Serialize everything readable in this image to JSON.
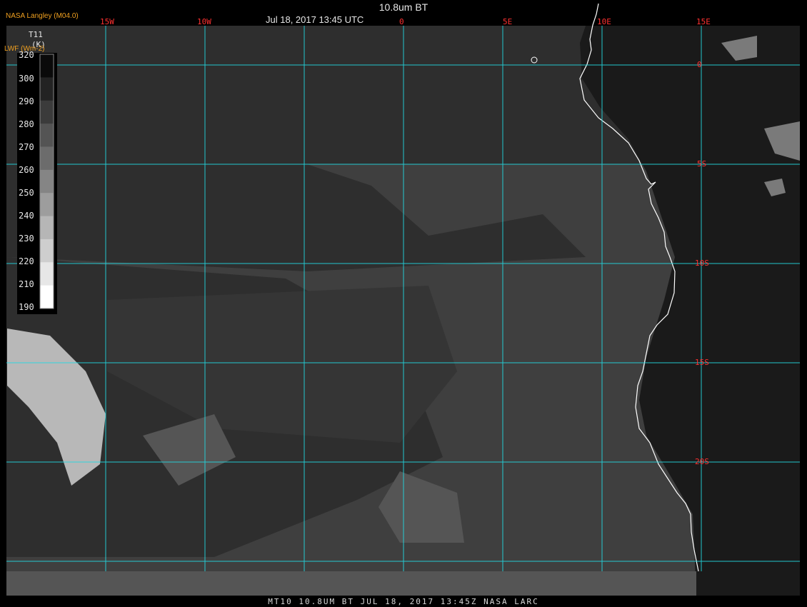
{
  "header": {
    "title": "10.8um BT",
    "subtitle": "Jul 18, 2017 13:45 UTC",
    "agency": "NASA Langley (M04.0)"
  },
  "legend": {
    "parameter": "T11",
    "unit": "(K)",
    "alt_label": "LWF (Wm-2)",
    "ticks": [
      "320",
      "300",
      "290",
      "280",
      "270",
      "260",
      "250",
      "240",
      "230",
      "220",
      "210",
      "190"
    ]
  },
  "grid": {
    "lon_labels": [
      "15W",
      "10W",
      "0",
      "5E",
      "10E",
      "15E"
    ],
    "lat_labels": [
      "0",
      "5S",
      "10S",
      "15S",
      "20S"
    ],
    "line_color": "#22d8e0",
    "label_color": "#ff3030"
  },
  "footer": {
    "caption": "MT10  10.8UM BT   JUL 18, 2017 13:45Z   NASA LARC"
  },
  "colors": {
    "coastline": "#ffffff",
    "ocean": "#3f3f3f",
    "land": "#141414"
  }
}
